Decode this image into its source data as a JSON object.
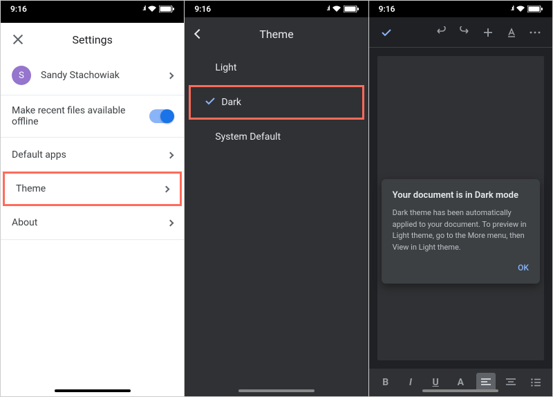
{
  "status": {
    "time": "9:16"
  },
  "screen1": {
    "title": "Settings",
    "account": {
      "initial": "S",
      "name": "Sandy Stachowiak"
    },
    "offline_label": "Make recent files available offline",
    "offline_on": true,
    "rows": {
      "default_apps": "Default apps",
      "theme": "Theme",
      "about": "About"
    }
  },
  "screen2": {
    "title": "Theme",
    "options": {
      "light": "Light",
      "dark": "Dark",
      "system": "System Default"
    },
    "selected": "dark"
  },
  "screen3": {
    "popup": {
      "title": "Your document is in Dark mode",
      "body": "Dark theme has been automatically applied to your document. To preview in Light theme, go to the More menu, then View in Light theme.",
      "ok": "OK"
    },
    "format": {
      "bold": "B",
      "italic": "I",
      "underline": "U",
      "textcolor": "A"
    }
  }
}
